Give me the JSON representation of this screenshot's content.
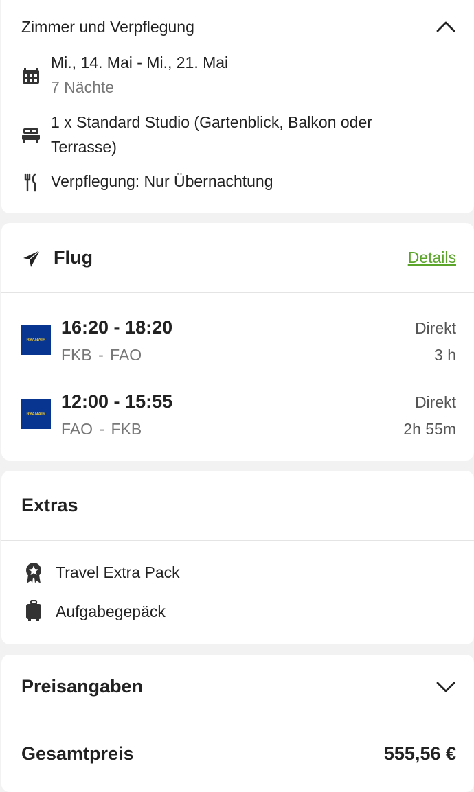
{
  "room": {
    "title": "Zimmer und Verpflegung",
    "dates": "Mi., 14. Mai - Mi., 21. Mai",
    "nights": "7 Nächte",
    "room_line1": "1 x Standard Studio (Gartenblick, Balkon oder",
    "room_line2": "Terrasse)",
    "board": "Verpflegung: Nur Übernachtung"
  },
  "flight": {
    "title": "Flug",
    "details_link": "Details",
    "legs": [
      {
        "airline": "RYANAIR",
        "times": "16:20 - 18:20",
        "route": "FKB - FAO",
        "type": "Direkt",
        "duration": "3 h"
      },
      {
        "airline": "RYANAIR",
        "times": "12:00 - 15:55",
        "route": "FAO - FKB",
        "type": "Direkt",
        "duration": "2h 55m"
      }
    ]
  },
  "extras": {
    "title": "Extras",
    "items": [
      {
        "label": "Travel Extra Pack",
        "icon": "badge-icon"
      },
      {
        "label": "Aufgabegepäck",
        "icon": "suitcase-icon"
      }
    ]
  },
  "price": {
    "title": "Preisangaben",
    "total_label": "Gesamtpreis",
    "total_value": "555,56 €"
  },
  "colors": {
    "link": "#5aa52a",
    "airline_bg": "#073590",
    "airline_fg": "#f1c933"
  }
}
